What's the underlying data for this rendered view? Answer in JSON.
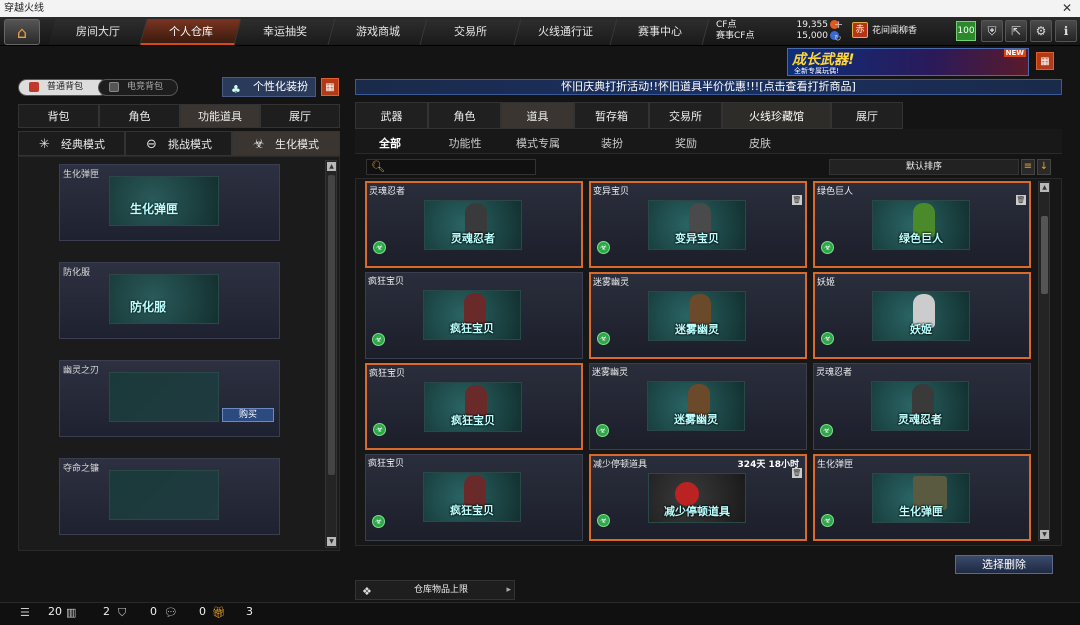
{
  "window": {
    "title": "穿越火线",
    "close_icon": "close-icon"
  },
  "topnav": {
    "tabs": [
      "房间大厅",
      "个人仓库",
      "幸运抽奖",
      "游戏商城",
      "交易所",
      "火线通行证",
      "赛事中心"
    ],
    "active": "个人仓库"
  },
  "currency": {
    "cf_label": "CF点",
    "cf_value": "19,355",
    "match_label": "赛事CF点",
    "match_value": "15,000"
  },
  "user": {
    "name": "花间闻柳香",
    "badge": "赤",
    "level": "100"
  },
  "banner": {
    "title": "成长武器!",
    "subtitle": "全新专属玩偶!",
    "new": "NEW"
  },
  "bags": {
    "normal": "普通背包",
    "esports": "电竞背包"
  },
  "custom_button": "个性化装扮",
  "left_tabs": [
    "背包",
    "角色",
    "功能道具",
    "展厅"
  ],
  "left_active": "功能道具",
  "mode_tabs": [
    "经典模式",
    "挑战模式",
    "生化模式"
  ],
  "mode_active": "生化模式",
  "left_items": [
    {
      "name": "生化弹匣",
      "label": "生化弹匣",
      "buy": ""
    },
    {
      "name": "防化服",
      "label": "防化服",
      "buy": ""
    },
    {
      "name": "幽灵之刃",
      "label": "",
      "buy": "购买"
    },
    {
      "name": "夺命之镰",
      "label": "",
      "buy": ""
    }
  ],
  "promo": "怀旧庆典打折活动!!怀旧道具半价优惠!!![点击查看打折商品]",
  "right_tabs": [
    "武器",
    "角色",
    "道具",
    "暂存箱",
    "交易所",
    "火线珍藏馆",
    "展厅"
  ],
  "right_active": "道具",
  "sub_tabs": [
    "全部",
    "功能性",
    "模式专属",
    "装扮",
    "奖励",
    "皮肤"
  ],
  "sub_active": "全部",
  "sort_label": "默认排序",
  "items": [
    {
      "name": "灵魂忍者",
      "label": "灵魂忍者",
      "extra": "",
      "hl": true,
      "trash": false
    },
    {
      "name": "变异宝贝",
      "label": "变异宝贝",
      "extra": "",
      "hl": true,
      "trash": true
    },
    {
      "name": "绿色巨人",
      "label": "绿色巨人",
      "extra": "",
      "hl": true,
      "trash": true
    },
    {
      "name": "疯狂宝贝",
      "label": "疯狂宝贝",
      "extra": "",
      "hl": false,
      "trash": false
    },
    {
      "name": "迷雾幽灵",
      "label": "迷雾幽灵",
      "extra": "",
      "hl": true,
      "trash": false
    },
    {
      "name": "妖姬",
      "label": "妖姬",
      "extra": "",
      "hl": true,
      "trash": false
    },
    {
      "name": "疯狂宝贝",
      "label": "疯狂宝贝",
      "extra": "",
      "hl": true,
      "trash": false
    },
    {
      "name": "迷雾幽灵",
      "label": "迷雾幽灵",
      "extra": "",
      "hl": false,
      "trash": false
    },
    {
      "name": "灵魂忍者",
      "label": "灵魂忍者",
      "extra": "",
      "hl": false,
      "trash": false
    },
    {
      "name": "疯狂宝贝",
      "label": "疯狂宝贝",
      "extra": "",
      "hl": false,
      "trash": false
    },
    {
      "name": "减少停顿道具",
      "label": "减少停顿道具",
      "extra": "324天 18小时",
      "hl": true,
      "trash": true
    },
    {
      "name": "生化弹匣",
      "label": "生化弹匣",
      "extra": "",
      "hl": true,
      "trash": false
    }
  ],
  "select_delete": "选择删除",
  "capacity": "仓库物品上限",
  "status": {
    "list": "20",
    "items": "2",
    "shield": "0",
    "chat": "0",
    "gift": "3"
  }
}
